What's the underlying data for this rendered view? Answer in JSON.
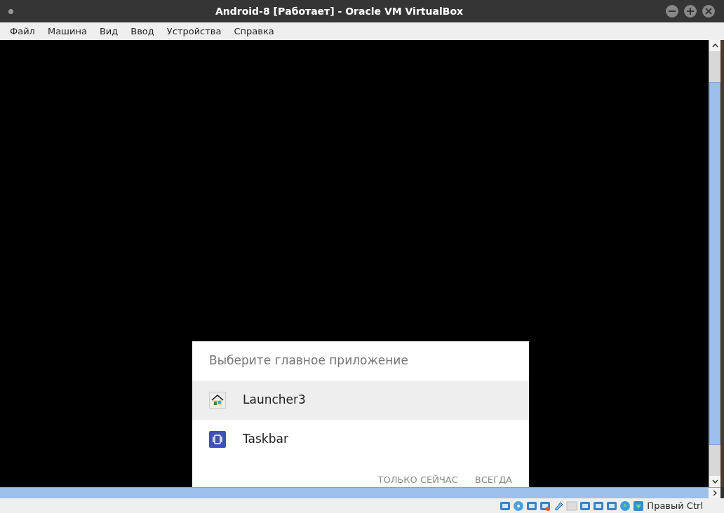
{
  "window": {
    "title": "Android-8 [Работает] - Oracle VM VirtualBox"
  },
  "menu": [
    "Файл",
    "Машина",
    "Вид",
    "Ввод",
    "Устройства",
    "Справка"
  ],
  "dialog": {
    "title": "Выберите главное приложение",
    "items": [
      {
        "label": "Launcher3",
        "kind": "home",
        "selected": true
      },
      {
        "label": "Taskbar",
        "kind": "taskbar",
        "selected": false
      }
    ],
    "buttons": [
      "ТОЛЬКО СЕЙЧАС",
      "ВСЕГДА"
    ]
  },
  "status_bar": {
    "host_key": "Правый Ctrl"
  }
}
